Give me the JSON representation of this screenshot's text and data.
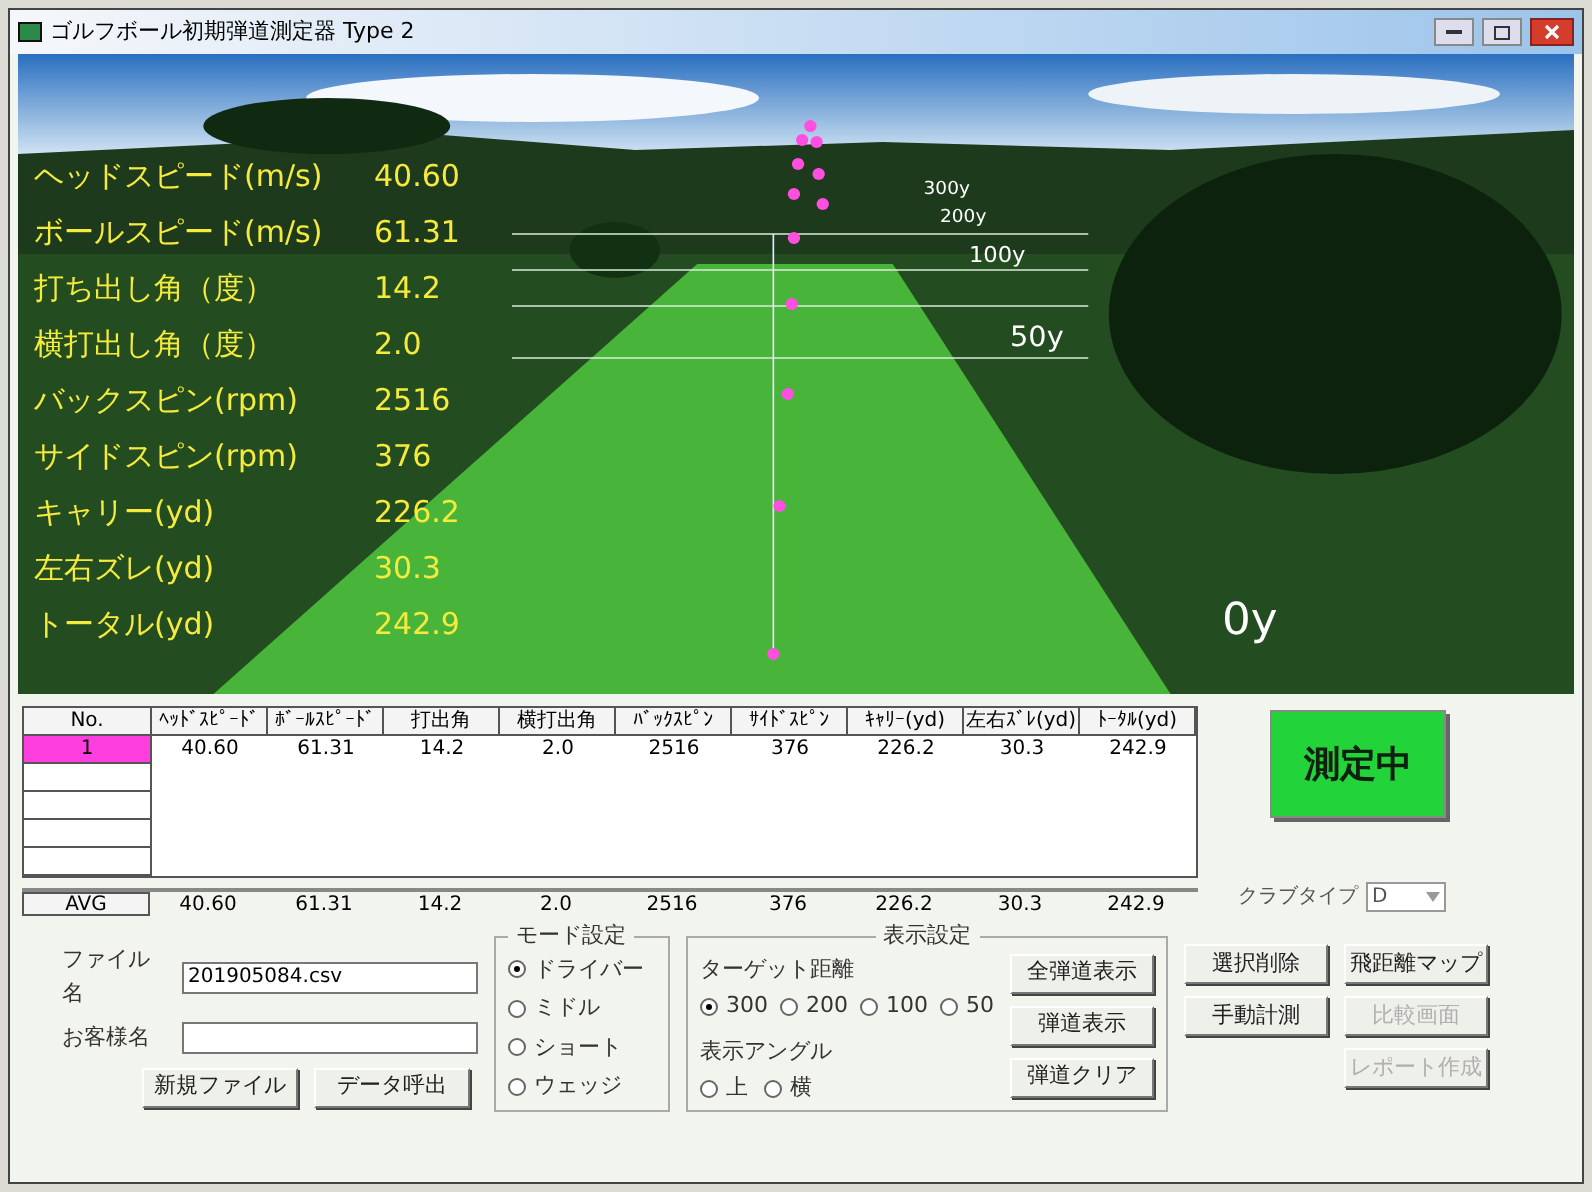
{
  "window": {
    "title": "ゴルフボール初期弾道測定器 Type 2"
  },
  "scene": {
    "distance_markers": [
      "300y",
      "200y",
      "100y",
      "50y",
      "0y"
    ]
  },
  "stats": [
    {
      "label": "ヘッドスピード(m/s)",
      "value": "40.60"
    },
    {
      "label": "ボールスピード(m/s)",
      "value": "61.31"
    },
    {
      "label": "打ち出し角（度）",
      "value": "14.2"
    },
    {
      "label": "横打出し角（度）",
      "value": "2.0"
    },
    {
      "label": "バックスピン(rpm)",
      "value": "2516"
    },
    {
      "label": "サイドスピン(rpm)",
      "value": "376"
    },
    {
      "label": "キャリー(yd)",
      "value": "226.2"
    },
    {
      "label": "左右ズレ(yd)",
      "value": "30.3"
    },
    {
      "label": "トータル(yd)",
      "value": "242.9"
    }
  ],
  "table": {
    "columns": [
      "No.",
      "ﾍｯﾄﾞｽﾋﾟｰﾄﾞ",
      "ﾎﾞｰﾙｽﾋﾟｰﾄﾞ",
      "打出角",
      "横打出角",
      "ﾊﾞｯｸｽﾋﾟﾝ",
      "ｻｲﾄﾞｽﾋﾟﾝ",
      "ｷｬﾘｰ(yd)",
      "左右ｽﾞﾚ(yd)",
      "ﾄｰﾀﾙ(yd)"
    ],
    "rows": [
      {
        "cells": [
          "1",
          "40.60",
          "61.31",
          "14.2",
          "2.0",
          "2516",
          "376",
          "226.2",
          "30.3",
          "242.9"
        ],
        "selected": true
      }
    ],
    "avg": {
      "label": "AVG",
      "values": [
        "40.60",
        "61.31",
        "14.2",
        "2.0",
        "2516",
        "376",
        "226.2",
        "30.3",
        "242.9"
      ]
    }
  },
  "measure_button": {
    "label": "測定中"
  },
  "club_type": {
    "label": "クラブタイプ",
    "value": "D"
  },
  "file": {
    "label": "ファイル名",
    "value": "201905084.csv"
  },
  "customer": {
    "label": "お客様名"
  },
  "file_buttons": [
    {
      "label": "新規ファイル",
      "disabled": false
    },
    {
      "label": "データ呼出",
      "disabled": false
    }
  ],
  "mode": {
    "title": "モード設定",
    "options": [
      {
        "label": "ドライバー",
        "selected": true
      },
      {
        "label": "ミドル",
        "selected": false
      },
      {
        "label": "ショート",
        "selected": false
      },
      {
        "label": "ウェッジ",
        "selected": false
      }
    ]
  },
  "display": {
    "title": "表示設定",
    "target_label": "ターゲット距離",
    "targets": [
      {
        "label": "300",
        "selected": true
      },
      {
        "label": "200",
        "selected": false
      },
      {
        "label": "100",
        "selected": false
      },
      {
        "label": "50",
        "selected": false
      }
    ],
    "angle_label": "表示アングル",
    "angles": [
      {
        "label": "上",
        "selected": false
      },
      {
        "label": "横",
        "selected": false
      }
    ]
  },
  "button_columns": [
    [
      {
        "label": "全弾道表示",
        "disabled": false
      },
      {
        "label": "弾道表示",
        "disabled": false
      },
      {
        "label": "弾道クリア",
        "disabled": false
      }
    ],
    [
      {
        "label": "選択削除",
        "disabled": false
      },
      {
        "label": "手動計測",
        "disabled": false
      }
    ],
    [
      {
        "label": "飛距離マップ",
        "disabled": false
      },
      {
        "label": "比較画面",
        "disabled": true
      },
      {
        "label": "レポート作成",
        "disabled": true
      }
    ]
  ]
}
